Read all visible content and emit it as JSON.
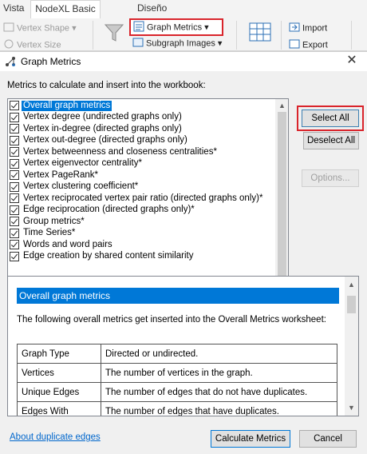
{
  "ribbon": {
    "tabs": {
      "vista": "Vista",
      "nodexl": "NodeXL Basic",
      "diseno": "Diseño"
    },
    "vertex_shape": "Vertex Shape",
    "vertex_size": "Vertex Size",
    "graph_metrics": "Graph Metrics",
    "subgraph_images": "Subgraph Images",
    "import": "Import",
    "export": "Export"
  },
  "dialog": {
    "title": "Graph Metrics",
    "close_glyph": "✕",
    "instruction": "Metrics to calculate and insert into the workbook:",
    "metrics": [
      {
        "label": "Overall graph metrics",
        "checked": true,
        "selected": true
      },
      {
        "label": "Vertex degree (undirected graphs only)",
        "checked": true
      },
      {
        "label": "Vertex in-degree (directed graphs only)",
        "checked": true
      },
      {
        "label": "Vertex out-degree (directed graphs only)",
        "checked": true
      },
      {
        "label": "Vertex betweenness and closeness centralities*",
        "checked": true
      },
      {
        "label": "Vertex eigenvector centrality*",
        "checked": true
      },
      {
        "label": "Vertex PageRank*",
        "checked": true
      },
      {
        "label": "Vertex clustering coefficient*",
        "checked": true
      },
      {
        "label": "Vertex reciprocated vertex pair ratio (directed graphs only)*",
        "checked": true
      },
      {
        "label": "Edge reciprocation (directed graphs only)*",
        "checked": true
      },
      {
        "label": "Group metrics*",
        "checked": true
      },
      {
        "label": "Time Series*",
        "checked": true
      },
      {
        "label": "Words and word pairs",
        "checked": true
      },
      {
        "label": "Edge creation by shared content similarity",
        "checked": true
      }
    ],
    "buttons": {
      "select_all": "Select All",
      "deselect_all": "Deselect All",
      "options": "Options...",
      "calculate": "Calculate Metrics",
      "cancel": "Cancel"
    },
    "help": {
      "heading": "Overall graph metrics",
      "description": "The following overall metrics get inserted into the Overall Metrics worksheet:",
      "rows": [
        {
          "name": "Graph Type",
          "desc": "Directed or undirected."
        },
        {
          "name": "Vertices",
          "desc": "The number of vertices in the graph."
        },
        {
          "name": "Unique Edges",
          "desc": "The number of edges that do not have duplicates."
        },
        {
          "name": "Edges With",
          "desc": "The number of edges that have duplicates."
        }
      ]
    },
    "about_link": "About duplicate edges"
  }
}
